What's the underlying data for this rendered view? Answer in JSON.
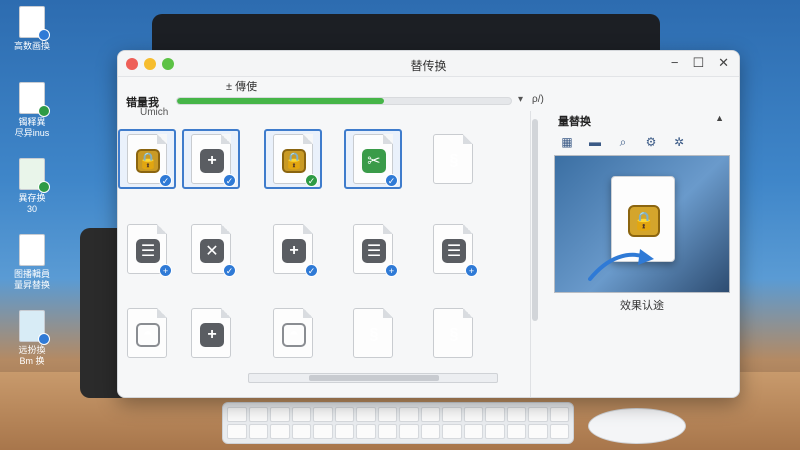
{
  "window": {
    "title": "替传换",
    "controls": {
      "minimize": "−",
      "maximize": "☐",
      "close": "✕"
    }
  },
  "toolbar": {
    "subtitle": "± 傳使",
    "title": "错量我",
    "sublabel": "Umich",
    "progress": 0.62,
    "dropdown_icon": "chevron-down-icon",
    "value": "ρ/)"
  },
  "desktop_icons": [
    {
      "label": "高数画換",
      "icon": "image-file-icon"
    },
    {
      "label": "镯释異\n尽异inus",
      "icon": "document-check-icon"
    },
    {
      "label": "異存换\n30",
      "icon": "spreadsheet-icon"
    },
    {
      "label": "图播輯員\n量昇替换",
      "icon": "document-icon"
    },
    {
      "label": "远扮換\nBm 换",
      "icon": "folder-check-icon"
    }
  ],
  "files": [
    {
      "icon": "lock-icon",
      "glyph": "🔒",
      "style": "gold",
      "badge": "check",
      "badge_color": "blue",
      "selected": true
    },
    {
      "icon": "plus-icon",
      "glyph": "+",
      "style": "gray",
      "badge": "check",
      "badge_color": "blue",
      "selected": true
    },
    {
      "icon": "lock-icon",
      "glyph": "🔒",
      "style": "gold",
      "badge": "check",
      "badge_color": "green",
      "selected": true
    },
    {
      "icon": "tools-icon",
      "glyph": "✂",
      "style": "green",
      "badge": "check",
      "badge_color": "blue",
      "selected": true
    },
    {
      "icon": "squiggle-icon",
      "glyph": "§",
      "style": "hollow",
      "badge": "",
      "badge_color": "",
      "selected": false
    },
    {
      "icon": "list-icon",
      "glyph": "☰",
      "style": "gray",
      "badge": "+",
      "badge_color": "blue",
      "selected": false
    },
    {
      "icon": "close-icon",
      "glyph": "✕",
      "style": "gray",
      "badge": "✓",
      "badge_color": "blue",
      "selected": false
    },
    {
      "icon": "plus-icon",
      "glyph": "+",
      "style": "gray",
      "badge": "✓",
      "badge_color": "blue",
      "selected": false
    },
    {
      "icon": "list-icon",
      "glyph": "☰",
      "style": "gray",
      "badge": "+",
      "badge_color": "blue",
      "selected": false
    },
    {
      "icon": "list-icon",
      "glyph": "☰",
      "style": "gray",
      "badge": "+",
      "badge_color": "blue",
      "selected": false
    },
    {
      "icon": "mushroom-icon",
      "glyph": "◓",
      "style": "outline",
      "badge": "",
      "badge_color": "",
      "selected": false
    },
    {
      "icon": "plus-icon",
      "glyph": "+",
      "style": "gray",
      "badge": "",
      "badge_color": "",
      "selected": false
    },
    {
      "icon": "mushroom-icon",
      "glyph": "◓",
      "style": "outline",
      "badge": "",
      "badge_color": "",
      "selected": false
    },
    {
      "icon": "squiggle-icon",
      "glyph": "§",
      "style": "hollow",
      "badge": "",
      "badge_color": "",
      "selected": false
    },
    {
      "icon": "squiggle-icon",
      "glyph": "§",
      "style": "hollow",
      "badge": "",
      "badge_color": "",
      "selected": false
    }
  ],
  "panel": {
    "title": "量替换",
    "collapse_icon": "chevron-up-icon",
    "tools": [
      {
        "name": "image-tool-icon",
        "glyph": "▦"
      },
      {
        "name": "folder-icon",
        "glyph": "▬"
      },
      {
        "name": "search-icon",
        "glyph": "⌕"
      },
      {
        "name": "gear-icon",
        "glyph": "⚙"
      },
      {
        "name": "settings-icon",
        "glyph": "✲"
      }
    ],
    "preview_glyph": "🔒",
    "caption": "效果认途"
  },
  "colors": {
    "accent": "#3f7ccc",
    "progress": "#46b548",
    "badge_blue": "#2f7ad6",
    "badge_green": "#2e9b45"
  }
}
